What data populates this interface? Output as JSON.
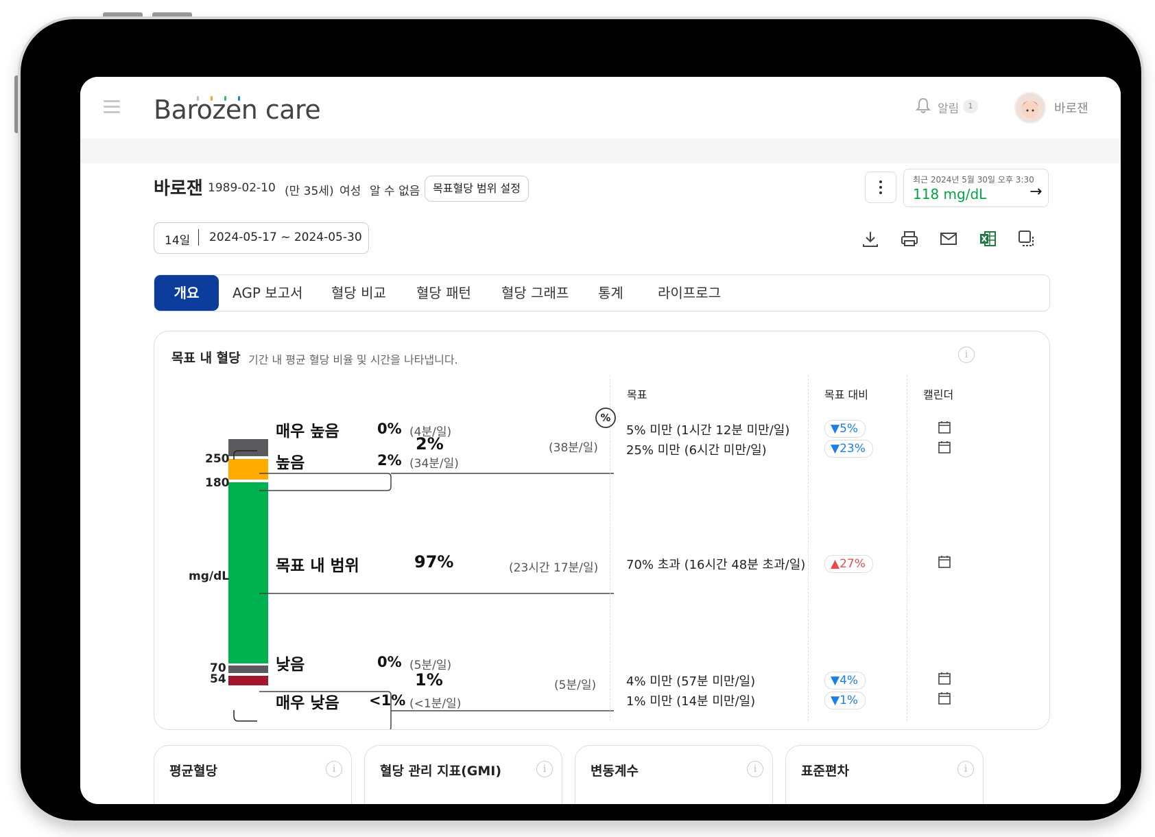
{
  "header": {
    "logo_text": "Barozen care",
    "notification_label": "알림",
    "notification_count": "1",
    "user_name": "바로잰"
  },
  "patient": {
    "name": "바로잰",
    "birth": "1989-02-10",
    "age": "(만 35세)",
    "gender": "여성",
    "type": "알 수 없음",
    "range_button": "목표혈당 범위 설정"
  },
  "latest": {
    "label": "최근 2024년 5월 30일 오후 3:30",
    "value": "118 mg/dL"
  },
  "date": {
    "days": "14일",
    "range": "2024-05-17 ~ 2024-05-30"
  },
  "tabs": [
    "개요",
    "AGP 보고서",
    "혈당 비교",
    "혈당 패턴",
    "혈당 그래프",
    "통계",
    "라이프로그"
  ],
  "card": {
    "title": "목표 내 혈당",
    "subtitle": "기간 내 평균 혈당 비율 및 시간을 나타냅니다.",
    "percent_toggle": "%",
    "columns": {
      "target": "목표",
      "vs_target": "목표 대비",
      "calendar": "캘린더"
    }
  },
  "chart_data": {
    "type": "bar",
    "ylabel": "mg/dL",
    "ticks": [
      "250",
      "180",
      "70",
      "54"
    ],
    "segments": [
      {
        "name": "매우 높음",
        "percent": "0%",
        "time": "(4분/일)",
        "color": "#5b5b5e"
      },
      {
        "name": "높음",
        "percent": "2%",
        "time": "(34분/일)",
        "color": "#ffab00"
      },
      {
        "name": "목표 내 범위",
        "percent": "97%",
        "time": "(23시간 17분/일)",
        "color": "#00b14f"
      },
      {
        "name": "낮음",
        "percent": "0%",
        "time": "(5분/일)",
        "color": "#5b5b5e"
      },
      {
        "name": "매우 낮음",
        "percent": "<1%",
        "time": "(<1분/일)",
        "color": "#a3182a"
      }
    ],
    "high_combined": {
      "percent": "2%",
      "time": "(38분/일)"
    },
    "low_combined": {
      "percent": "1%",
      "time": "(5분/일)"
    }
  },
  "targets": [
    {
      "text": "5% 미만 (1시간 12분 미만/일)",
      "delta": "5%",
      "direction": "down"
    },
    {
      "text": "25% 미만 (6시간 미만/일)",
      "delta": "23%",
      "direction": "down"
    },
    {
      "text": "70% 초과 (16시간 48분 초과/일)",
      "delta": "27%",
      "direction": "up"
    },
    {
      "text": "4% 미만 (57분 미만/일)",
      "delta": "4%",
      "direction": "down"
    },
    {
      "text": "1% 미만 (14분 미만/일)",
      "delta": "1%",
      "direction": "down"
    }
  ],
  "bottom_cards": [
    "평균혈당",
    "혈당 관리 지표(GMI)",
    "변동계수",
    "표준편차"
  ],
  "colors": {
    "accent": "#0c3d9c",
    "green": "#00a544",
    "down": "#1a7fe8",
    "up": "#e94b4b"
  }
}
